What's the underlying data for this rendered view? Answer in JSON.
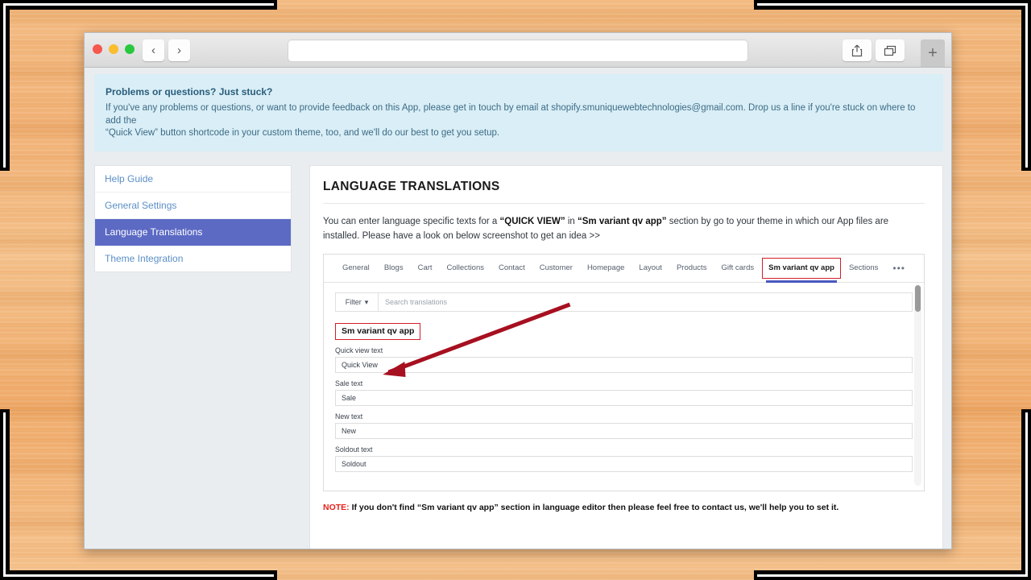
{
  "browser": {
    "url_value": "",
    "url_placeholder": "",
    "back_icon": "‹",
    "forward_icon": "›",
    "share_icon": "share-icon",
    "tabs_icon": "tabs-icon",
    "new_tab_label": "+"
  },
  "banner": {
    "title": "Problems or questions? Just stuck?",
    "line1": "If you've any problems or questions, or want to provide feedback on this App, please get in touch by email at shopify.smuniquewebtechnologies@gmail.com. Drop us a line if you're stuck on where to add the",
    "line2": "“Quick View” button shortcode in your custom theme, too, and we'll do our best to get you setup."
  },
  "sidebar": {
    "items": [
      {
        "label": "Help Guide",
        "active": false
      },
      {
        "label": "General Settings",
        "active": false
      },
      {
        "label": "Language Translations",
        "active": true
      },
      {
        "label": "Theme Integration",
        "active": false
      }
    ]
  },
  "main": {
    "title": "LANGUAGE TRANSLATIONS",
    "intro_1": "You can enter language specific texts for a ",
    "intro_q1": "“QUICK VIEW”",
    "intro_2": " in ",
    "intro_q2": "“Sm variant qv app”",
    "intro_3": " section by go to your theme in which our App files are installed. Please have a look on below screenshot to get an idea >>",
    "note_label": "NOTE:",
    "note_text": " If you don't find “Sm variant qv app” section in language editor then please feel free to contact us, we'll help you to set it."
  },
  "screenshot": {
    "tabs": [
      {
        "label": "General",
        "selected": false
      },
      {
        "label": "Blogs",
        "selected": false
      },
      {
        "label": "Cart",
        "selected": false
      },
      {
        "label": "Collections",
        "selected": false
      },
      {
        "label": "Contact",
        "selected": false
      },
      {
        "label": "Customer",
        "selected": false
      },
      {
        "label": "Homepage",
        "selected": false
      },
      {
        "label": "Layout",
        "selected": false
      },
      {
        "label": "Products",
        "selected": false
      },
      {
        "label": "Gift cards",
        "selected": false
      },
      {
        "label": "Sm variant qv app",
        "selected": true
      },
      {
        "label": "Sections",
        "selected": false
      },
      {
        "label": "•••",
        "selected": false
      }
    ],
    "filter_label": "Filter",
    "filter_caret": "▾",
    "search_placeholder": "Search translations",
    "section_name": "Sm variant qv app",
    "fields": [
      {
        "label": "Quick view text",
        "value": "Quick View"
      },
      {
        "label": "Sale text",
        "value": "Sale"
      },
      {
        "label": "New text",
        "value": "New"
      },
      {
        "label": "Soldout text",
        "value": "Soldout"
      }
    ]
  },
  "colors": {
    "accent": "#5c6ac4",
    "banner_bg": "#d9eef6",
    "annotation_red": "#a61020",
    "highlight_red": "#d21f26",
    "note_red": "#e8201a",
    "wood": "#f4b378"
  }
}
